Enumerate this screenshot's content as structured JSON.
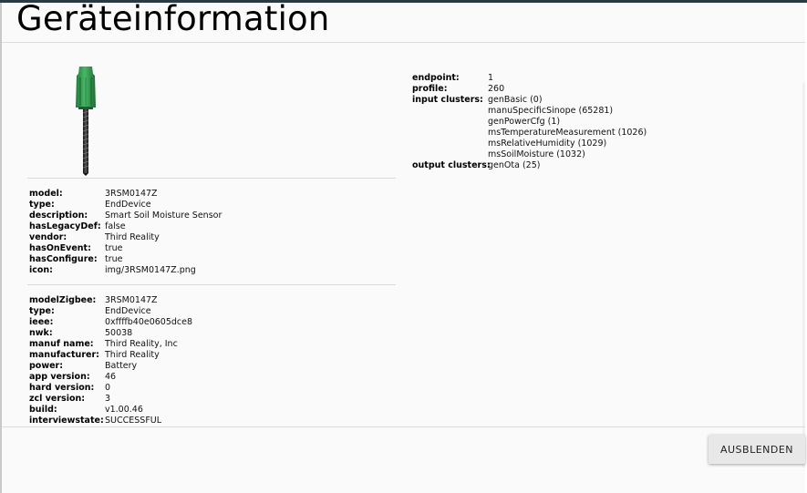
{
  "dialog": {
    "title": "Geräteinformation",
    "hide_label": "AUSBLENDEN"
  },
  "device": {
    "icon_name": "soil-moisture-sensor-image",
    "info": [
      {
        "key": "model:",
        "value": "3RSM0147Z"
      },
      {
        "key": "type:",
        "value": "EndDevice"
      },
      {
        "key": "description:",
        "value": "Smart Soil Moisture Sensor"
      },
      {
        "key": "hasLegacyDef:",
        "value": "false"
      },
      {
        "key": "vendor:",
        "value": "Third Reality"
      },
      {
        "key": "hasOnEvent:",
        "value": "true"
      },
      {
        "key": "hasConfigure:",
        "value": "true"
      },
      {
        "key": "icon:",
        "value": "img/3RSM0147Z.png"
      }
    ],
    "zigbee": [
      {
        "key": "modelZigbee:",
        "value": "3RSM0147Z"
      },
      {
        "key": "type:",
        "value": "EndDevice"
      },
      {
        "key": "ieee:",
        "value": "0xffffb40e0605dce8"
      },
      {
        "key": "nwk:",
        "value": "50038"
      },
      {
        "key": "manuf name:",
        "value": "Third Reality, Inc"
      },
      {
        "key": "manufacturer:",
        "value": "Third Reality"
      },
      {
        "key": "power:",
        "value": "Battery"
      },
      {
        "key": "app version:",
        "value": "46"
      },
      {
        "key": "hard version:",
        "value": "0"
      },
      {
        "key": "zcl version:",
        "value": "3"
      },
      {
        "key": "build:",
        "value": "v1.00.46"
      },
      {
        "key": "interviewstate:",
        "value": "SUCCESSFUL"
      }
    ]
  },
  "endpoint": {
    "endpoint_key": "endpoint:",
    "endpoint_value": "1",
    "profile_key": "profile:",
    "profile_value": "260",
    "input_key": "input clusters:",
    "input_clusters": [
      "genBasic (0)",
      "manuSpecificSinope (65281)",
      "genPowerCfg (1)",
      "msTemperatureMeasurement (1026)",
      "msRelativeHumidity (1029)",
      "msSoilMoisture (1032)"
    ],
    "output_key": "output clusters:",
    "output_clusters": [
      "genOta (25)"
    ]
  },
  "colors": {
    "accent_link": "#2a6fb0",
    "sensor_green": "#3aa55a",
    "background": "#fafafa"
  }
}
